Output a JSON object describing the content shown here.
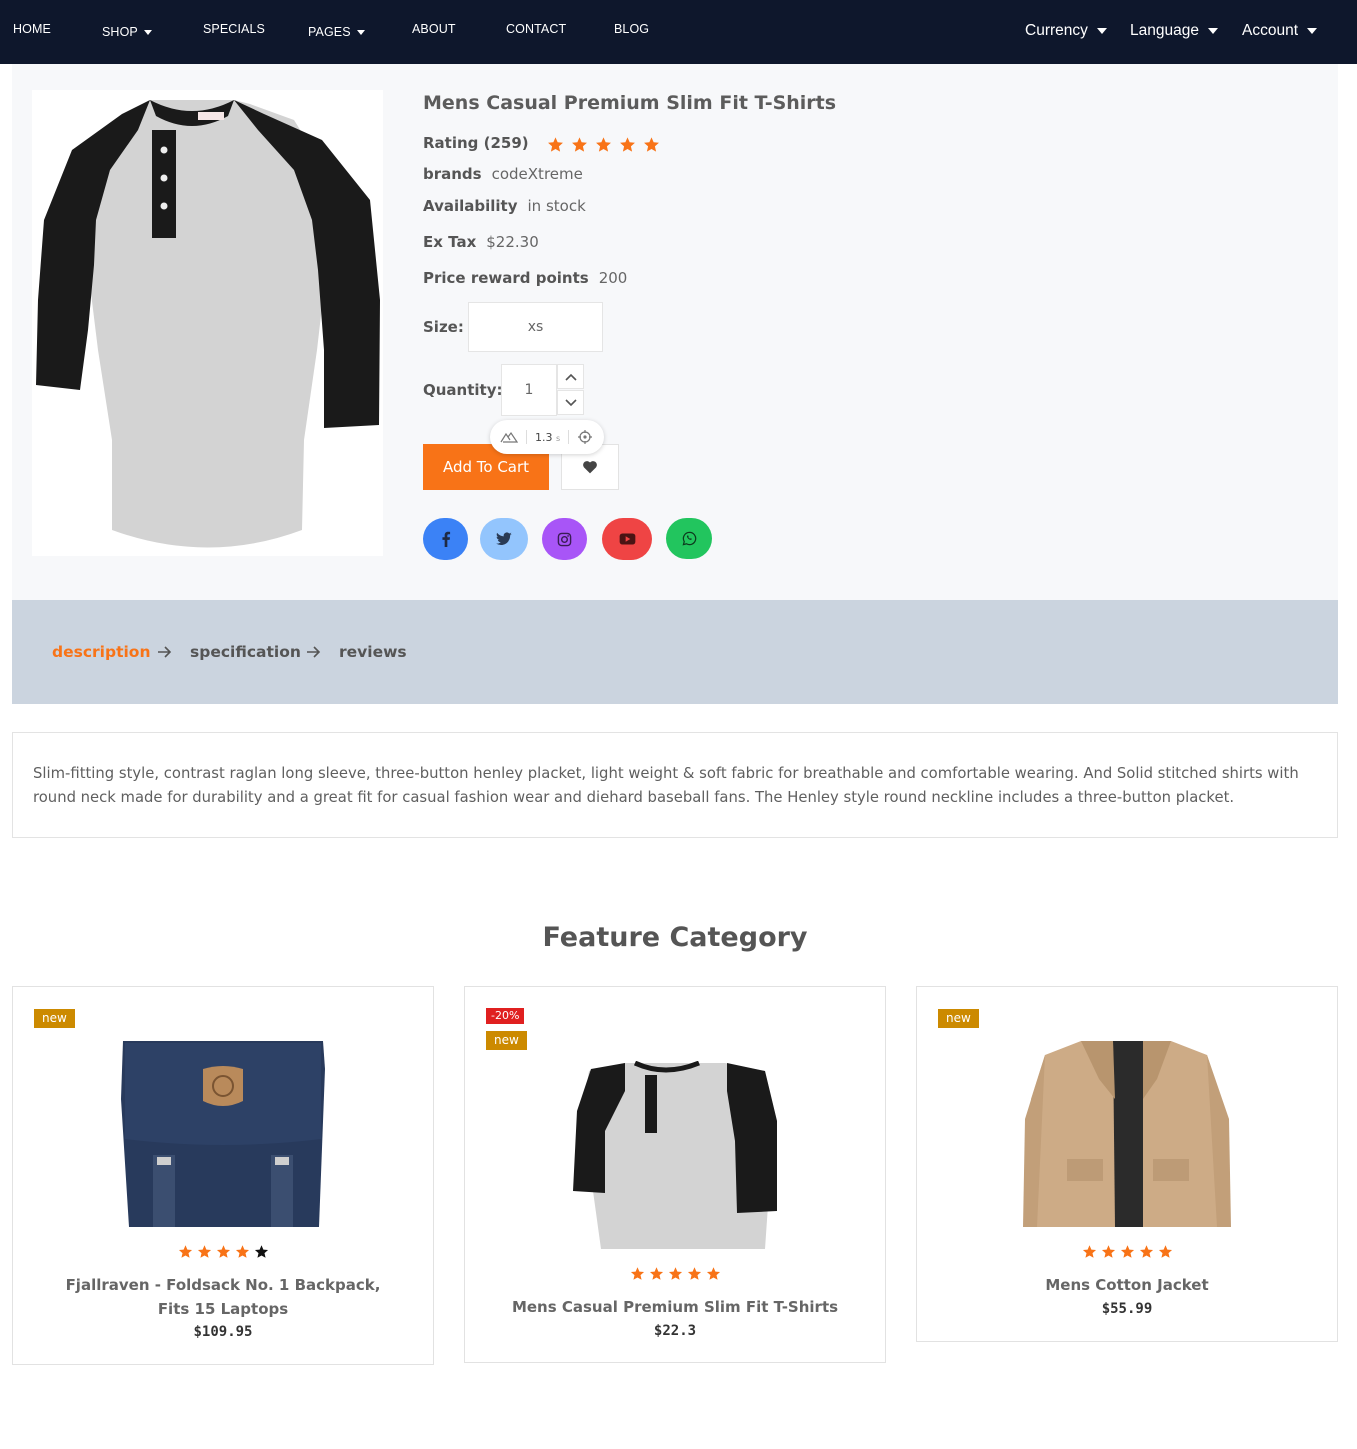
{
  "nav": {
    "left": [
      {
        "label": "HOME",
        "dropdown": false
      },
      {
        "label": "SHOP",
        "dropdown": true
      },
      {
        "label": "SPECIALS",
        "dropdown": false
      },
      {
        "label": "PAGES",
        "dropdown": true
      },
      {
        "label": "ABOUT",
        "dropdown": false
      },
      {
        "label": "CONTACT",
        "dropdown": false
      },
      {
        "label": "BLOG",
        "dropdown": false
      }
    ],
    "right": [
      {
        "label": "Currency"
      },
      {
        "label": "Language"
      },
      {
        "label": "Account"
      }
    ]
  },
  "product": {
    "title": "Mens Casual Premium Slim Fit T-Shirts",
    "rating_label": "Rating (259)",
    "rating_stars": 5,
    "brand_label": "brands",
    "brand_value": "codeXtreme",
    "availability_label": "Availability",
    "availability_value": "in stock",
    "extax_label": "Ex Tax",
    "extax_value": "$22.30",
    "reward_label": "Price reward points",
    "reward_value": "200",
    "size_label": "Size:",
    "size_value": "xs",
    "quantity_label": "Quantity:",
    "quantity_value": "1",
    "add_to_cart_label": "Add To Cart",
    "devtool_value": "1.3",
    "devtool_unit": "s",
    "social": [
      {
        "name": "facebook",
        "color": "#3b82f6"
      },
      {
        "name": "twitter",
        "color": "#93c5fd"
      },
      {
        "name": "instagram",
        "color": "#a855f7"
      },
      {
        "name": "youtube",
        "color": "#ef4444"
      },
      {
        "name": "whatsapp",
        "color": "#22c55e"
      }
    ]
  },
  "tabs": {
    "items": [
      "description",
      "specification",
      "reviews"
    ],
    "active": "description"
  },
  "description": "Slim-fitting style, contrast raglan long sleeve, three-button henley placket, light weight & soft fabric for breathable and comfortable wearing. And Solid stitched shirts with round neck made for durability and a great fit for casual fashion wear and diehard baseball fans. The Henley style round neckline includes a three-button placket.",
  "feature": {
    "title": "Feature Category",
    "cards": [
      {
        "badges": [
          "new"
        ],
        "name": "Fjallraven - Foldsack No. 1 Backpack, Fits 15 Laptops",
        "price": "$109.95",
        "rating": 4,
        "image": "backpack"
      },
      {
        "badges": [
          "-20%",
          "new"
        ],
        "name": "Mens Casual Premium Slim Fit T-Shirts",
        "price": "$22.3",
        "rating": 5,
        "image": "tshirt"
      },
      {
        "badges": [
          "new"
        ],
        "name": "Mens Cotton Jacket",
        "price": "$55.99",
        "rating": 5,
        "image": "jacket"
      }
    ]
  },
  "colors": {
    "accent": "#f87317",
    "nav_bg": "#0e172c",
    "tab_bg": "#cbd4df",
    "badge_new": "#cc8a00",
    "badge_sale": "#e02020"
  }
}
